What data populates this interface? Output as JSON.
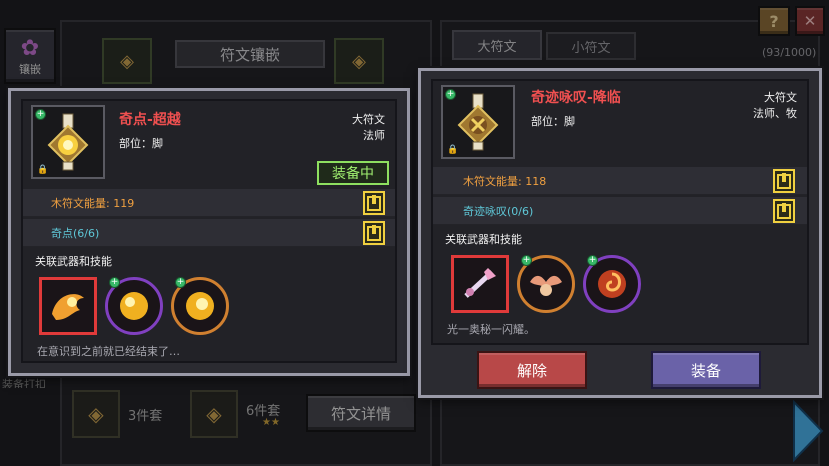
{
  "top_right": {
    "help_label": "?",
    "close_label": "✕",
    "count": "(93/1000)"
  },
  "left_panel": {
    "tab_inlay": "镶嵌",
    "header_title": "符文镶嵌",
    "partial_label": "装备打扣",
    "set3_label": "3件套",
    "set6_label": "6件套",
    "stars": "★★",
    "details_button": "符文详情"
  },
  "right_panel": {
    "tab_big": "大符文",
    "tab_small": "小符文"
  },
  "card_left": {
    "name": "奇点-超越",
    "part": "部位：脚",
    "category": "大符文",
    "class": "法师",
    "equipped_badge": "装备中",
    "stat1": "木符文能量: 119",
    "stat2": "奇点(6/6)",
    "related_header": "关联武器和技能",
    "description": "在意识到之前就已经结束了…"
  },
  "card_right": {
    "name": "奇迹咏叹-降临",
    "part": "部位：脚",
    "category": "大符文",
    "class": "法师、牧",
    "stat1": "木符文能量: 118",
    "stat2": "奇迹咏叹(0/6)",
    "related_header": "关联武器和技能",
    "description": "光一奥秘一闪耀。",
    "unequip_button": "解除",
    "equip_button": "装备"
  },
  "colors": {
    "accent_red": "#f05050",
    "energy_orange": "#f0a040",
    "set_teal": "#5fc8d8",
    "equipped_green": "#8ee060",
    "lock_yellow": "#f0d040"
  }
}
